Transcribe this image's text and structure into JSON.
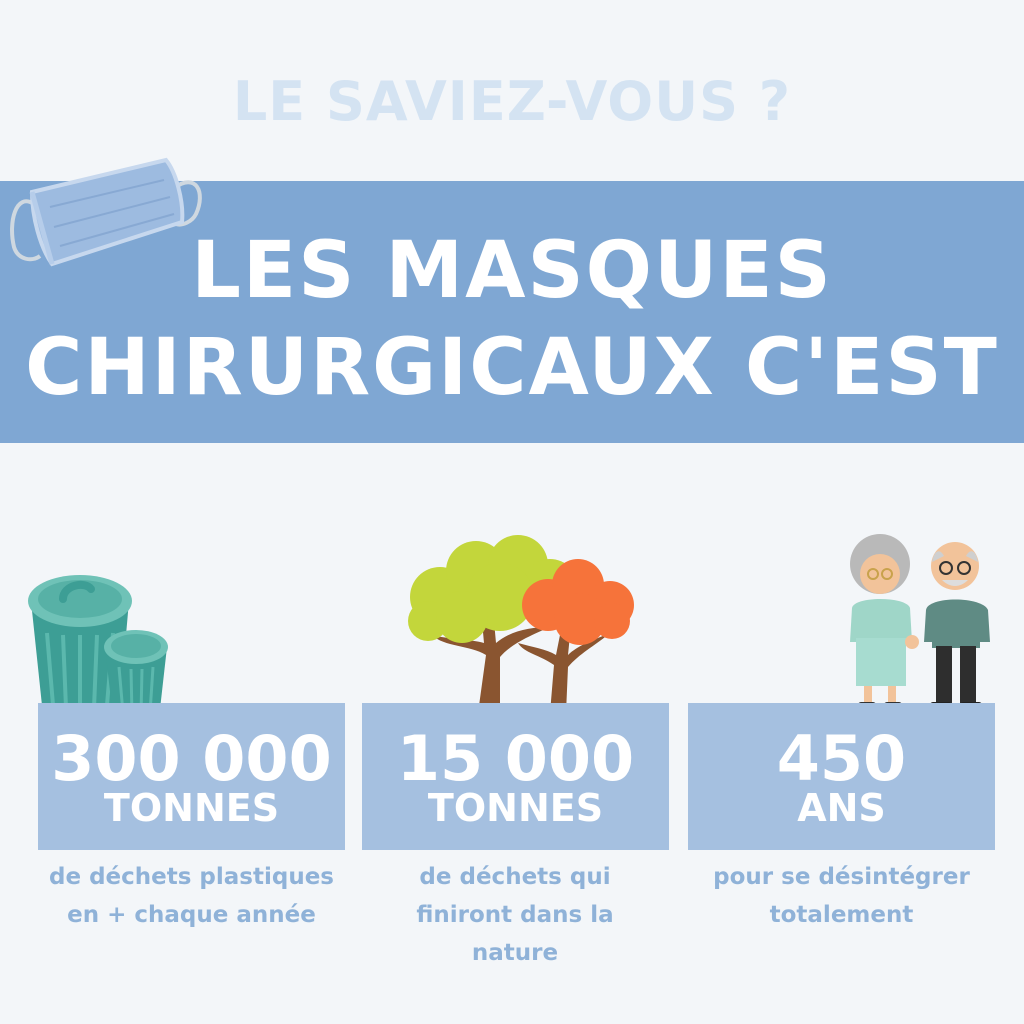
{
  "header": {
    "kicker": "LE SAVIEZ-VOUS ?",
    "title_line_1": "LES MASQUES",
    "title_line_2": "CHIRURGICAUX C'EST"
  },
  "stats": [
    {
      "value": "300 000",
      "unit": "TONNES",
      "caption_lines": [
        "de déchets plastiques",
        "en + chaque année"
      ],
      "icon": "trash-can-icon"
    },
    {
      "value": "15 000",
      "unit": "TONNES",
      "caption_lines": [
        "de déchets qui",
        "finiront dans la",
        "nature"
      ],
      "icon": "trees-icon"
    },
    {
      "value": "450",
      "unit": "ANS",
      "caption_lines": [
        "pour se désintégrer",
        "totalement"
      ],
      "icon": "elderly-couple-icon"
    }
  ],
  "decorations": {
    "mask": "surgical-mask-icon"
  },
  "colors": {
    "background": "#f3f6f9",
    "banner": "#7fa7d3",
    "stat_box": "#a5c0e0",
    "caption_text": "#8fb2d8",
    "kicker_text": "#d4e3f2"
  }
}
